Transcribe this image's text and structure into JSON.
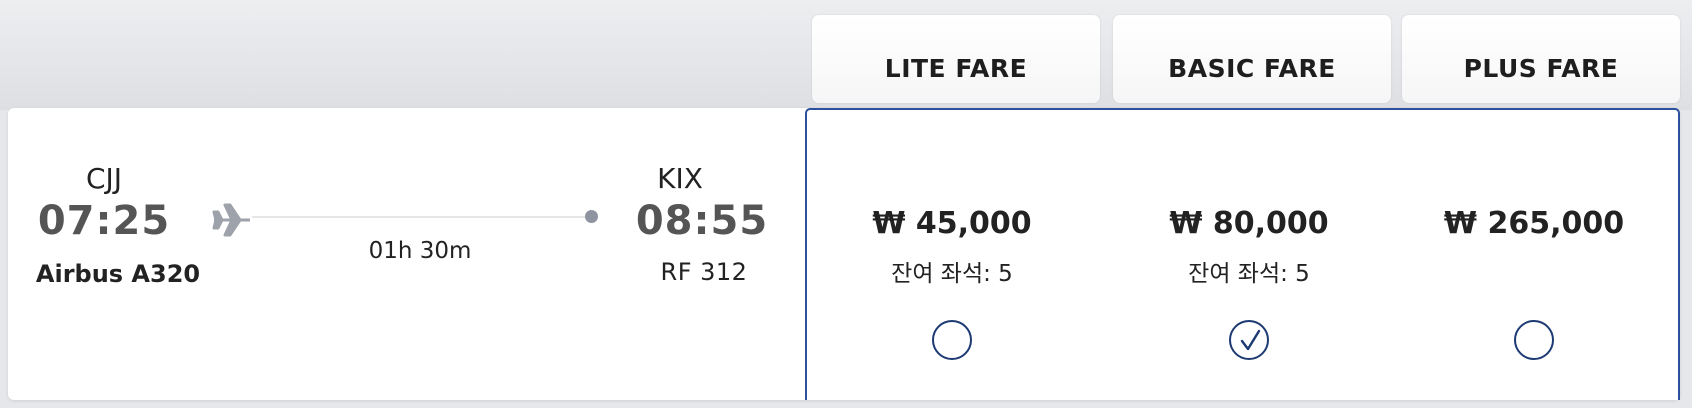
{
  "header": {
    "cutoff_text": "… , … , … , … …"
  },
  "fare_tabs": [
    {
      "label": "LITE FARE"
    },
    {
      "label": "BASIC FARE"
    },
    {
      "label": "PLUS FARE"
    }
  ],
  "flight": {
    "departure": {
      "code": "CJJ",
      "time": "07:25"
    },
    "arrival": {
      "code": "KIX",
      "time": "08:55"
    },
    "aircraft": "Airbus A320",
    "duration": "01h 30m",
    "flight_number": "RF 312"
  },
  "fares": [
    {
      "price": "₩ 45,000",
      "seats": "잔여 좌석: 5",
      "selected": false
    },
    {
      "price": "₩ 80,000",
      "seats": "잔여 좌석: 5",
      "selected": true
    },
    {
      "price": "₩ 265,000",
      "seats": "",
      "selected": false
    }
  ],
  "icons": {
    "plane": "airplane-icon",
    "check": "check-icon"
  },
  "colors": {
    "accent": "#2c4f9e",
    "radio_border": "#1d3a73",
    "muted_time": "#555555"
  }
}
